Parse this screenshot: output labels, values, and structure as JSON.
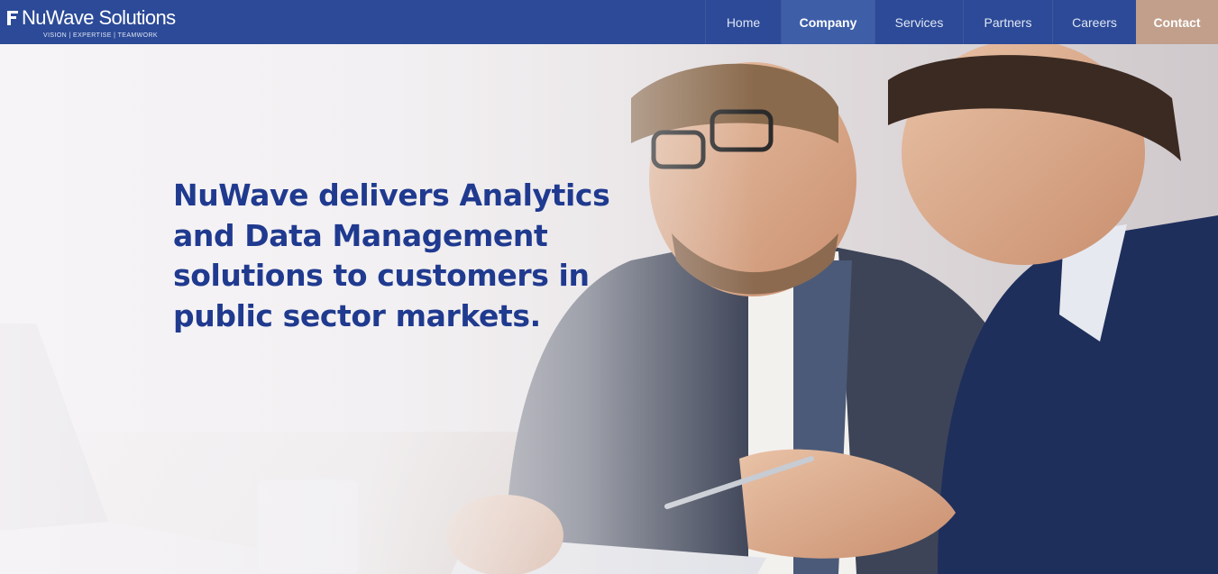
{
  "brand": {
    "name": "NuWave Solutions",
    "tagline": "VISION | EXPERTISE | TEAMWORK"
  },
  "nav": {
    "items": [
      {
        "label": "Home",
        "active": false
      },
      {
        "label": "Company",
        "active": true
      },
      {
        "label": "Services",
        "active": false
      },
      {
        "label": "Partners",
        "active": false
      },
      {
        "label": "Careers",
        "active": false
      },
      {
        "label": "Contact",
        "active": false
      }
    ]
  },
  "hero": {
    "headline": "NuWave delivers Analytics and Data Management solutions to customers in public sector markets."
  },
  "colors": {
    "nav_bg": "#2c4a97",
    "nav_active_bg": "#3e5ea8",
    "contact_bg": "#c19f8b",
    "headline": "#1f3a8f"
  }
}
